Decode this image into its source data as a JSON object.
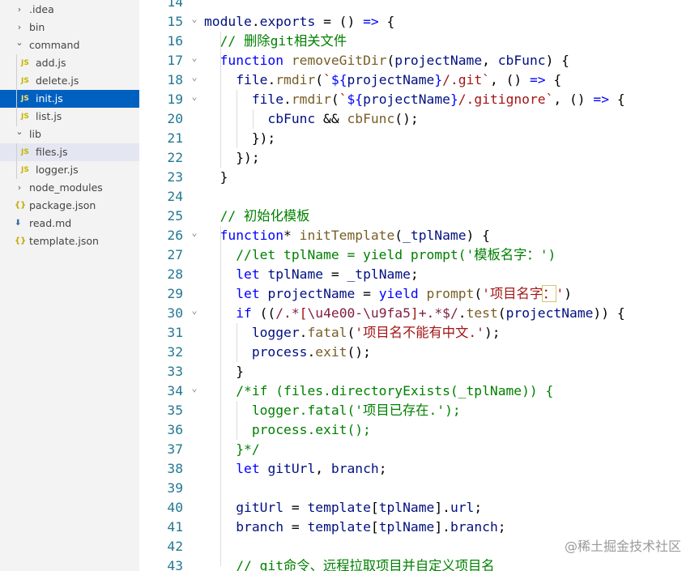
{
  "sidebar": {
    "items": [
      {
        "label": ".idea",
        "type": "folder",
        "state": "collapsed"
      },
      {
        "label": "bin",
        "type": "folder",
        "state": "collapsed"
      },
      {
        "label": "command",
        "type": "folder",
        "state": "expanded"
      },
      {
        "label": "add.js",
        "type": "js",
        "icon": "JS"
      },
      {
        "label": "delete.js",
        "type": "js",
        "icon": "JS"
      },
      {
        "label": "init.js",
        "type": "js",
        "icon": "JS",
        "selected": true
      },
      {
        "label": "list.js",
        "type": "js",
        "icon": "JS"
      },
      {
        "label": "lib",
        "type": "folder",
        "state": "expanded"
      },
      {
        "label": "files.js",
        "type": "js",
        "icon": "JS",
        "hover": true
      },
      {
        "label": "logger.js",
        "type": "js",
        "icon": "JS"
      },
      {
        "label": "node_modules",
        "type": "folder",
        "state": "collapsed"
      },
      {
        "label": "package.json",
        "type": "json",
        "icon": "{}"
      },
      {
        "label": "read.md",
        "type": "md",
        "icon": "⬇"
      },
      {
        "label": "template.json",
        "type": "json",
        "icon": "{}"
      }
    ]
  },
  "editor": {
    "lines": [
      {
        "num": "14",
        "fold": false,
        "tokens": []
      },
      {
        "num": "15",
        "fold": true,
        "tokens": [
          [
            "vr",
            "module"
          ],
          [
            "op",
            "."
          ],
          [
            "vr",
            "exports"
          ],
          [
            "op",
            " = () "
          ],
          [
            "kw",
            "=>"
          ],
          [
            "op",
            " {"
          ]
        ]
      },
      {
        "num": "16",
        "fold": false,
        "tokens": [
          [
            "op",
            "  "
          ],
          [
            "cm",
            "// 删除git相关文件"
          ]
        ]
      },
      {
        "num": "17",
        "fold": true,
        "tokens": [
          [
            "op",
            "  "
          ],
          [
            "kw",
            "function"
          ],
          [
            "op",
            " "
          ],
          [
            "fn",
            "removeGitDir"
          ],
          [
            "op",
            "("
          ],
          [
            "vr",
            "projectName"
          ],
          [
            "op",
            ", "
          ],
          [
            "vr",
            "cbFunc"
          ],
          [
            "op",
            ") {"
          ]
        ]
      },
      {
        "num": "18",
        "fold": true,
        "tokens": [
          [
            "op",
            "    "
          ],
          [
            "vr",
            "file"
          ],
          [
            "op",
            "."
          ],
          [
            "fn",
            "rmdir"
          ],
          [
            "op",
            "("
          ],
          [
            "str",
            "`"
          ],
          [
            "kw",
            "${"
          ],
          [
            "vr",
            "projectName"
          ],
          [
            "kw",
            "}"
          ],
          [
            "str",
            "/.git`"
          ],
          [
            "op",
            ", () "
          ],
          [
            "kw",
            "=>"
          ],
          [
            "op",
            " {"
          ]
        ]
      },
      {
        "num": "19",
        "fold": true,
        "tokens": [
          [
            "op",
            "      "
          ],
          [
            "vr",
            "file"
          ],
          [
            "op",
            "."
          ],
          [
            "fn",
            "rmdir"
          ],
          [
            "op",
            "("
          ],
          [
            "str",
            "`"
          ],
          [
            "kw",
            "${"
          ],
          [
            "vr",
            "projectName"
          ],
          [
            "kw",
            "}"
          ],
          [
            "str",
            "/.gitignore`"
          ],
          [
            "op",
            ", () "
          ],
          [
            "kw",
            "=>"
          ],
          [
            "op",
            " {"
          ]
        ]
      },
      {
        "num": "20",
        "fold": false,
        "tokens": [
          [
            "op",
            "        "
          ],
          [
            "vr",
            "cbFunc"
          ],
          [
            "op",
            " && "
          ],
          [
            "fn",
            "cbFunc"
          ],
          [
            "op",
            "();"
          ]
        ]
      },
      {
        "num": "21",
        "fold": false,
        "tokens": [
          [
            "op",
            "      });"
          ]
        ]
      },
      {
        "num": "22",
        "fold": false,
        "tokens": [
          [
            "op",
            "    });"
          ]
        ]
      },
      {
        "num": "23",
        "fold": false,
        "tokens": [
          [
            "op",
            "  }"
          ]
        ]
      },
      {
        "num": "24",
        "fold": false,
        "tokens": []
      },
      {
        "num": "25",
        "fold": false,
        "tokens": [
          [
            "op",
            "  "
          ],
          [
            "cm",
            "// 初始化模板"
          ]
        ]
      },
      {
        "num": "26",
        "fold": true,
        "tokens": [
          [
            "op",
            "  "
          ],
          [
            "kw",
            "function"
          ],
          [
            "op",
            "* "
          ],
          [
            "fn",
            "initTemplate"
          ],
          [
            "op",
            "("
          ],
          [
            "vr",
            "_tplName"
          ],
          [
            "op",
            ") {"
          ]
        ]
      },
      {
        "num": "27",
        "fold": false,
        "tokens": [
          [
            "op",
            "    "
          ],
          [
            "cm",
            "//let tplName = yield prompt('模板名字：')"
          ]
        ]
      },
      {
        "num": "28",
        "fold": false,
        "tokens": [
          [
            "op",
            "    "
          ],
          [
            "kw",
            "let"
          ],
          [
            "op",
            " "
          ],
          [
            "vr",
            "tplName"
          ],
          [
            "op",
            " = "
          ],
          [
            "vr",
            "_tplName"
          ],
          [
            "op",
            ";"
          ]
        ]
      },
      {
        "num": "29",
        "fold": false,
        "tokens": [
          [
            "op",
            "    "
          ],
          [
            "kw",
            "let"
          ],
          [
            "op",
            " "
          ],
          [
            "vr",
            "projectName"
          ],
          [
            "op",
            " = "
          ],
          [
            "kw",
            "yield"
          ],
          [
            "op",
            " "
          ],
          [
            "fn",
            "prompt"
          ],
          [
            "op",
            "("
          ],
          [
            "str",
            "'项目名字"
          ],
          [
            "sel",
            "："
          ],
          [
            "str",
            "'"
          ],
          [
            "op",
            ")"
          ]
        ]
      },
      {
        "num": "30",
        "fold": true,
        "tokens": [
          [
            "op",
            "    "
          ],
          [
            "kw",
            "if"
          ],
          [
            "op",
            " (("
          ],
          [
            "rx",
            "/.*"
          ],
          [
            "str",
            "["
          ],
          [
            "rx",
            "\\u4e00-\\u9fa5"
          ],
          [
            "str",
            "]"
          ],
          [
            "rx",
            "+.*$/"
          ],
          [
            "op",
            "."
          ],
          [
            "fn",
            "test"
          ],
          [
            "op",
            "("
          ],
          [
            "vr",
            "projectName"
          ],
          [
            "op",
            ")) {"
          ]
        ]
      },
      {
        "num": "31",
        "fold": false,
        "tokens": [
          [
            "op",
            "      "
          ],
          [
            "vr",
            "logger"
          ],
          [
            "op",
            "."
          ],
          [
            "fn",
            "fatal"
          ],
          [
            "op",
            "("
          ],
          [
            "str",
            "'项目名不能有中文.'"
          ],
          [
            "op",
            ");"
          ]
        ]
      },
      {
        "num": "32",
        "fold": false,
        "tokens": [
          [
            "op",
            "      "
          ],
          [
            "vr",
            "process"
          ],
          [
            "op",
            "."
          ],
          [
            "fn",
            "exit"
          ],
          [
            "op",
            "();"
          ]
        ]
      },
      {
        "num": "33",
        "fold": false,
        "tokens": [
          [
            "op",
            "    }"
          ]
        ]
      },
      {
        "num": "34",
        "fold": true,
        "tokens": [
          [
            "op",
            "    "
          ],
          [
            "cm",
            "/*if (files.directoryExists(_tplName)) {"
          ]
        ]
      },
      {
        "num": "35",
        "fold": false,
        "tokens": [
          [
            "op",
            "      "
          ],
          [
            "cm",
            "logger.fatal('项目已存在.');"
          ]
        ]
      },
      {
        "num": "36",
        "fold": false,
        "tokens": [
          [
            "op",
            "      "
          ],
          [
            "cm",
            "process.exit();"
          ]
        ]
      },
      {
        "num": "37",
        "fold": false,
        "tokens": [
          [
            "op",
            "    "
          ],
          [
            "cm",
            "}*/"
          ]
        ]
      },
      {
        "num": "38",
        "fold": false,
        "tokens": [
          [
            "op",
            "    "
          ],
          [
            "kw",
            "let"
          ],
          [
            "op",
            " "
          ],
          [
            "vr",
            "gitUrl"
          ],
          [
            "op",
            ", "
          ],
          [
            "vr",
            "branch"
          ],
          [
            "op",
            ";"
          ]
        ]
      },
      {
        "num": "39",
        "fold": false,
        "tokens": []
      },
      {
        "num": "40",
        "fold": false,
        "tokens": [
          [
            "op",
            "    "
          ],
          [
            "vr",
            "gitUrl"
          ],
          [
            "op",
            " = "
          ],
          [
            "vr",
            "template"
          ],
          [
            "op",
            "["
          ],
          [
            "vr",
            "tplName"
          ],
          [
            "op",
            "]."
          ],
          [
            "vr",
            "url"
          ],
          [
            "op",
            ";"
          ]
        ]
      },
      {
        "num": "41",
        "fold": false,
        "tokens": [
          [
            "op",
            "    "
          ],
          [
            "vr",
            "branch"
          ],
          [
            "op",
            " = "
          ],
          [
            "vr",
            "template"
          ],
          [
            "op",
            "["
          ],
          [
            "vr",
            "tplName"
          ],
          [
            "op",
            "]."
          ],
          [
            "vr",
            "branch"
          ],
          [
            "op",
            ";"
          ]
        ]
      },
      {
        "num": "42",
        "fold": false,
        "tokens": []
      },
      {
        "num": "43",
        "fold": false,
        "tokens": [
          [
            "op",
            "    "
          ],
          [
            "cm",
            "// git命令、远程拉取项目并自定义项目名"
          ]
        ]
      }
    ]
  },
  "watermark": "@稀土掘金技术社区",
  "colors": {
    "selected_bg": "#0060c0",
    "line_number": "#237893",
    "keyword": "#0000ff",
    "comment": "#008000",
    "string": "#a31515",
    "function": "#795e26",
    "variable": "#001080"
  }
}
